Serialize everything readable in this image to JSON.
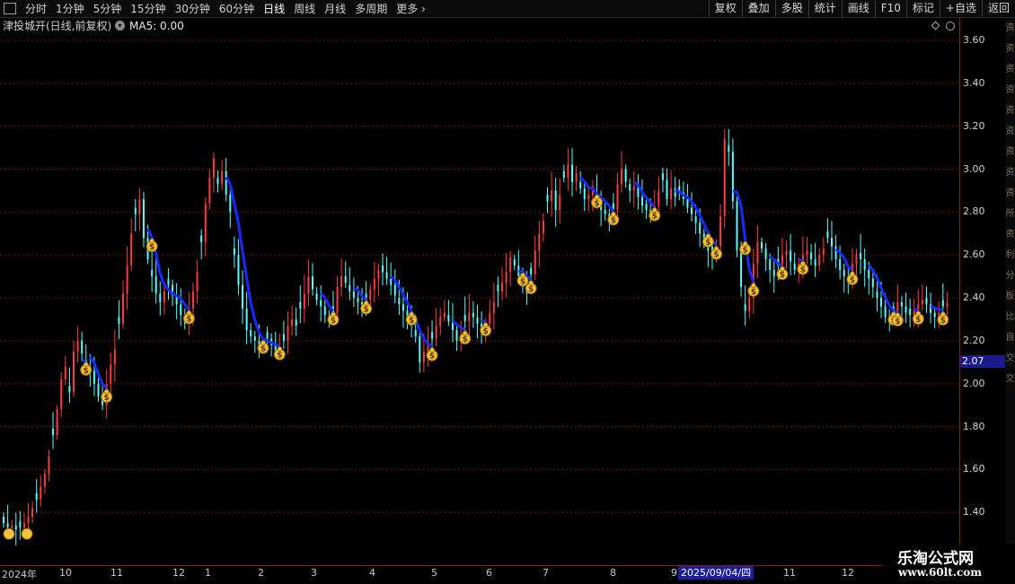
{
  "toolbar": {
    "tabs": [
      "分时",
      "1分钟",
      "5分钟",
      "15分钟",
      "30分钟",
      "60分钟",
      "日线",
      "周线",
      "月线",
      "多周期",
      "更多"
    ],
    "active_tab": "日线",
    "right_buttons": [
      "复权",
      "叠加",
      "多股",
      "统计",
      "画线",
      "F10",
      "标记",
      "+自选",
      "返回"
    ]
  },
  "info": {
    "stock_name": "津投城开(日线,前复权)",
    "ma_label": "MA5: 0.00"
  },
  "price_tag": "2.07",
  "side_chars": [
    "资",
    "资",
    "资",
    "资",
    "资",
    "资",
    "资",
    "资",
    "资",
    "所",
    "资",
    "利",
    "分",
    "板",
    "比",
    "自",
    "交",
    "交"
  ],
  "watermark": {
    "line1": "乐淘公式网",
    "line2": "www.60lt.com"
  },
  "date_badge": "2025/09/04/四",
  "colors": {
    "up": "#ff3c3c",
    "down": "#54ffff",
    "ma": "#1a2aff",
    "grid": "#6a1515",
    "axis": "#8b1a1a"
  },
  "chart_data": {
    "type": "candlestick",
    "y_ticks": [
      "3.60",
      "3.40",
      "3.20",
      "3.00",
      "2.80",
      "2.60",
      "2.40",
      "2.20",
      "2.00",
      "1.80",
      "1.60",
      "1.40"
    ],
    "x_labels": [
      "2024年",
      "10",
      "11",
      "12",
      "1",
      "2",
      "3",
      "4",
      "5",
      "6",
      "7",
      "8",
      "9",
      "11",
      "12"
    ],
    "ylim": [
      1.3,
      3.65
    ],
    "ma_series": "MA5",
    "closes": [
      1.35,
      1.33,
      1.34,
      1.32,
      1.33,
      1.35,
      1.38,
      1.42,
      1.46,
      1.52,
      1.58,
      1.66,
      1.76,
      1.88,
      2.02,
      2.08,
      1.96,
      2.15,
      2.2,
      2.14,
      2.08,
      2.06,
      2.0,
      1.94,
      1.9,
      2.0,
      2.09,
      2.16,
      2.28,
      2.42,
      2.55,
      2.7,
      2.79,
      2.86,
      2.68,
      2.58,
      2.5,
      2.42,
      2.38,
      2.43,
      2.46,
      2.41,
      2.37,
      2.32,
      2.28,
      2.35,
      2.43,
      2.52,
      2.66,
      2.84,
      2.96,
      3.05,
      2.93,
      2.99,
      2.88,
      2.8,
      2.6,
      2.46,
      2.35,
      2.25,
      2.22,
      2.2,
      2.18,
      2.19,
      2.21,
      2.18,
      2.15,
      2.16,
      2.2,
      2.27,
      2.3,
      2.27,
      2.35,
      2.42,
      2.5,
      2.44,
      2.39,
      2.36,
      2.32,
      2.3,
      2.33,
      2.45,
      2.5,
      2.47,
      2.43,
      2.4,
      2.38,
      2.36,
      2.39,
      2.44,
      2.49,
      2.53,
      2.52,
      2.49,
      2.46,
      2.41,
      2.37,
      2.34,
      2.31,
      2.27,
      2.22,
      2.1,
      2.15,
      2.19,
      2.21,
      2.27,
      2.31,
      2.33,
      2.29,
      2.25,
      2.2,
      2.23,
      2.29,
      2.33,
      2.31,
      2.28,
      2.25,
      2.28,
      2.33,
      2.38,
      2.43,
      2.47,
      2.52,
      2.59,
      2.55,
      2.5,
      2.45,
      2.42,
      2.51,
      2.62,
      2.7,
      2.76,
      2.85,
      2.9,
      2.81,
      2.88,
      2.96,
      3.02,
      2.94,
      2.98,
      2.91,
      2.86,
      2.88,
      2.92,
      2.86,
      2.81,
      2.79,
      2.76,
      2.81,
      2.93,
      3.0,
      2.94,
      2.9,
      2.92,
      2.87,
      2.83,
      2.81,
      2.79,
      2.83,
      2.9,
      2.95,
      2.86,
      2.91,
      2.87,
      2.89,
      2.86,
      2.82,
      2.79,
      2.75,
      2.7,
      2.66,
      2.62,
      2.61,
      2.64,
      2.78,
      3.14,
      3.08,
      2.85,
      2.62,
      2.45,
      2.34,
      2.4,
      2.56,
      2.66,
      2.63,
      2.58,
      2.53,
      2.5,
      2.55,
      2.6,
      2.62,
      2.57,
      2.53,
      2.56,
      2.6,
      2.62,
      2.58,
      2.55,
      2.6,
      2.63,
      2.68,
      2.64,
      2.58,
      2.53,
      2.5,
      2.47,
      2.56,
      2.6,
      2.58,
      2.53,
      2.49,
      2.45,
      2.4,
      2.36,
      2.31,
      2.3,
      2.33,
      2.38,
      2.36,
      2.33,
      2.32,
      2.34,
      2.37,
      2.39,
      2.37,
      2.33,
      2.31,
      2.33,
      2.36,
      2.38
    ]
  }
}
